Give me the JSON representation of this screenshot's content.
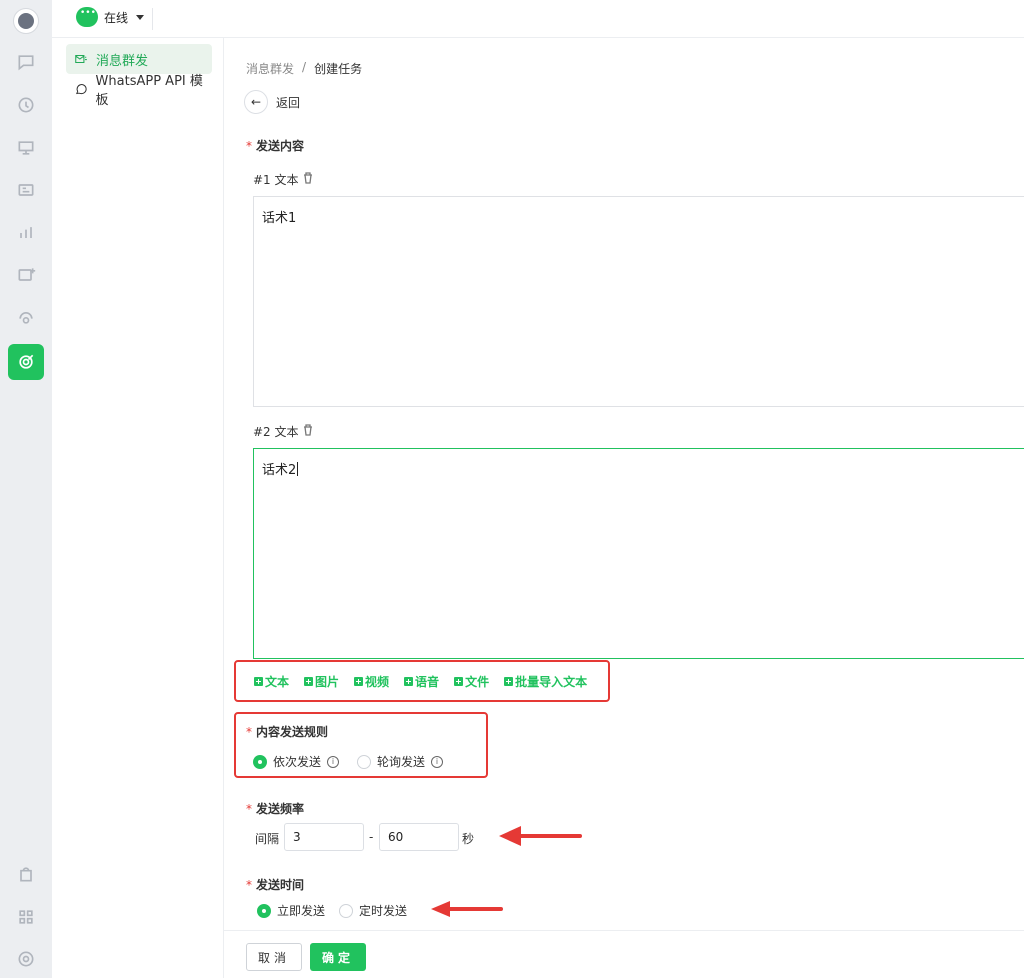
{
  "topbar": {
    "status_label": "在线"
  },
  "subnav": {
    "items": [
      {
        "label": "消息群发",
        "icon": "send-mail-icon"
      },
      {
        "label": "WhatsAPP API 模板",
        "icon": "whatsapp-icon"
      }
    ]
  },
  "breadcrumb": {
    "parent": "消息群发",
    "separator": "/",
    "current": "创建任务"
  },
  "back": {
    "label": "返回"
  },
  "content": {
    "section_label": "发送内容",
    "items": [
      {
        "title": "#1 文本",
        "value": "话术1"
      },
      {
        "title": "#2 文本",
        "value": "话术2"
      }
    ],
    "add_buttons": [
      "文本",
      "图片",
      "视频",
      "语音",
      "文件",
      "批量导入文本"
    ]
  },
  "rule": {
    "label": "内容发送规则",
    "options": [
      "依次发送",
      "轮询发送"
    ],
    "selected": "依次发送"
  },
  "frequency": {
    "label": "发送频率",
    "prefix": "间隔",
    "min": "3",
    "separator": "-",
    "max": "60",
    "unit": "秒"
  },
  "time": {
    "label": "发送时间",
    "options": [
      "立即发送",
      "定时发送"
    ],
    "selected": "立即发送"
  },
  "footer": {
    "cancel": "取消",
    "confirm": "确定"
  },
  "colors": {
    "accent": "#21c25e",
    "annotation": "#e53935"
  }
}
